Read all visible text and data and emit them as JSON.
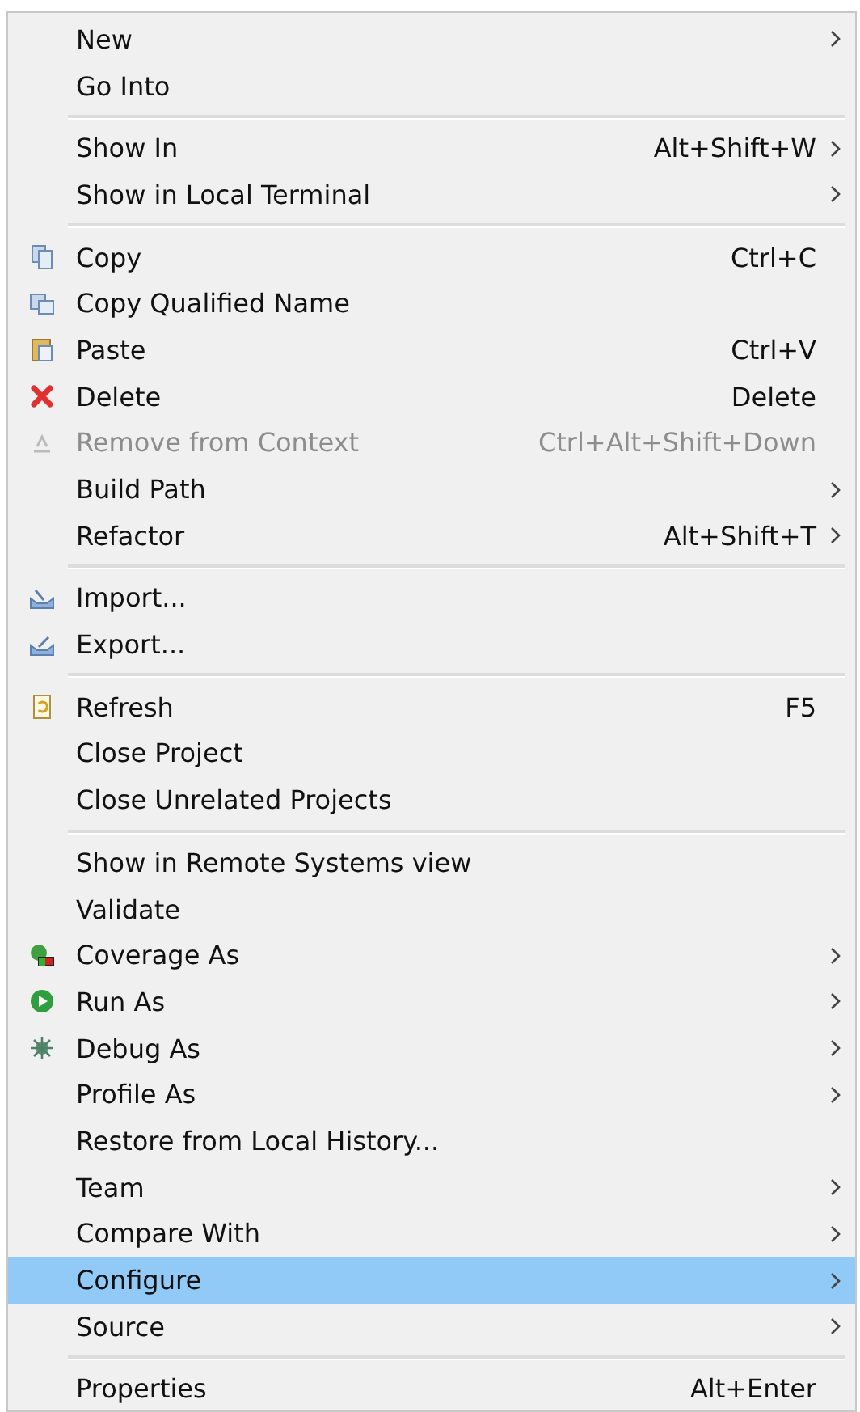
{
  "menu": {
    "groups": [
      [
        {
          "label": "New",
          "submenu": true,
          "disabled": false,
          "selected": false
        },
        {
          "label": "Go Into",
          "submenu": false,
          "disabled": false,
          "selected": false
        }
      ],
      [
        {
          "label": "Show In",
          "shortcut": "Alt+Shift+W",
          "submenu": true,
          "disabled": false,
          "selected": false
        },
        {
          "label": "Show in Local Terminal",
          "submenu": true,
          "disabled": false,
          "selected": false
        }
      ],
      [
        {
          "label": "Copy",
          "shortcut": "Ctrl+C",
          "submenu": false,
          "disabled": false,
          "selected": false
        },
        {
          "label": "Copy Qualified Name",
          "submenu": false,
          "disabled": false,
          "selected": false
        },
        {
          "label": "Paste",
          "shortcut": "Ctrl+V",
          "submenu": false,
          "disabled": false,
          "selected": false
        },
        {
          "label": "Delete",
          "shortcut": "Delete",
          "submenu": false,
          "disabled": false,
          "selected": false
        },
        {
          "label": "Remove from Context",
          "shortcut": "Ctrl+Alt+Shift+Down",
          "submenu": false,
          "disabled": true,
          "selected": false
        },
        {
          "label": "Build Path",
          "submenu": true,
          "disabled": false,
          "selected": false
        },
        {
          "label": "Refactor",
          "shortcut": "Alt+Shift+T",
          "submenu": true,
          "disabled": false,
          "selected": false
        }
      ],
      [
        {
          "label": "Import...",
          "submenu": false,
          "disabled": false,
          "selected": false
        },
        {
          "label": "Export...",
          "submenu": false,
          "disabled": false,
          "selected": false
        }
      ],
      [
        {
          "label": "Refresh",
          "shortcut": "F5",
          "submenu": false,
          "disabled": false,
          "selected": false
        },
        {
          "label": "Close Project",
          "submenu": false,
          "disabled": false,
          "selected": false
        },
        {
          "label": "Close Unrelated Projects",
          "submenu": false,
          "disabled": false,
          "selected": false
        }
      ],
      [
        {
          "label": "Show in Remote Systems view",
          "submenu": false,
          "disabled": false,
          "selected": false
        },
        {
          "label": "Validate",
          "submenu": false,
          "disabled": false,
          "selected": false
        },
        {
          "label": "Coverage As",
          "submenu": true,
          "disabled": false,
          "selected": false
        },
        {
          "label": "Run As",
          "submenu": true,
          "disabled": false,
          "selected": false
        },
        {
          "label": "Debug As",
          "submenu": true,
          "disabled": false,
          "selected": false
        },
        {
          "label": "Profile As",
          "submenu": true,
          "disabled": false,
          "selected": false
        },
        {
          "label": "Restore from Local History...",
          "submenu": false,
          "disabled": false,
          "selected": false
        },
        {
          "label": "Team",
          "submenu": true,
          "disabled": false,
          "selected": false
        },
        {
          "label": "Compare With",
          "submenu": true,
          "disabled": false,
          "selected": false
        },
        {
          "label": "Configure",
          "submenu": true,
          "disabled": false,
          "selected": true
        },
        {
          "label": "Source",
          "submenu": true,
          "disabled": false,
          "selected": false
        }
      ],
      [
        {
          "label": "Properties",
          "shortcut": "Alt+Enter",
          "submenu": false,
          "disabled": false,
          "selected": false
        }
      ]
    ]
  }
}
